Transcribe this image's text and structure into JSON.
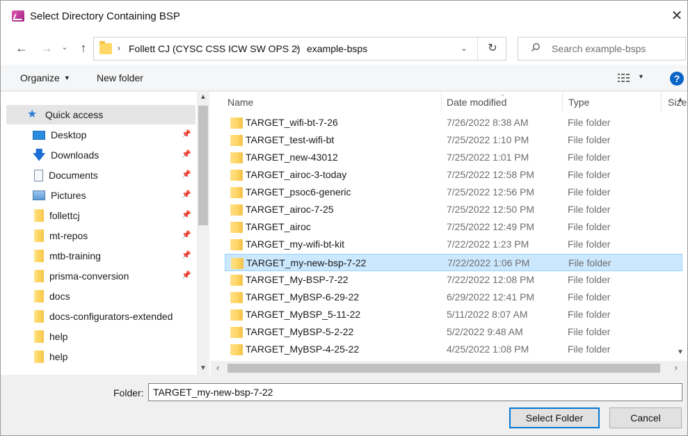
{
  "window": {
    "title": "Select Directory Containing BSP"
  },
  "address": {
    "crumbs": [
      "Follett CJ (CYSC CSS ICW SW OPS 2)",
      "example-bsps"
    ]
  },
  "search": {
    "placeholder": "Search example-bsps"
  },
  "toolbar": {
    "organize": "Organize",
    "new_folder": "New folder"
  },
  "sidebar": {
    "items": [
      {
        "label": "Quick access",
        "icon": "star-icon",
        "pinned": false
      },
      {
        "label": "Desktop",
        "icon": "desktop-icon",
        "pinned": true
      },
      {
        "label": "Downloads",
        "icon": "download-icon",
        "pinned": true
      },
      {
        "label": "Documents",
        "icon": "documents-icon",
        "pinned": true
      },
      {
        "label": "Pictures",
        "icon": "pictures-icon",
        "pinned": true
      },
      {
        "label": "follettcj",
        "icon": "folder-icon",
        "pinned": true
      },
      {
        "label": "mt-repos",
        "icon": "folder-icon",
        "pinned": true
      },
      {
        "label": "mtb-training",
        "icon": "folder-icon",
        "pinned": true
      },
      {
        "label": "prisma-conversion",
        "icon": "folder-icon",
        "pinned": true
      },
      {
        "label": "docs",
        "icon": "folder-icon",
        "pinned": false
      },
      {
        "label": "docs-configurators-extended",
        "icon": "folder-icon",
        "pinned": false
      },
      {
        "label": "help",
        "icon": "folder-icon",
        "pinned": false
      },
      {
        "label": "help",
        "icon": "folder-icon",
        "pinned": false
      }
    ]
  },
  "columns": {
    "name": "Name",
    "date": "Date modified",
    "type": "Type",
    "size": "Size"
  },
  "files": [
    {
      "name": "TARGET_wifi-bt-7-26",
      "date": "7/26/2022 8:38 AM",
      "type": "File folder"
    },
    {
      "name": "TARGET_test-wifi-bt",
      "date": "7/25/2022 1:10 PM",
      "type": "File folder"
    },
    {
      "name": "TARGET_new-43012",
      "date": "7/25/2022 1:01 PM",
      "type": "File folder"
    },
    {
      "name": "TARGET_airoc-3-today",
      "date": "7/25/2022 12:58 PM",
      "type": "File folder"
    },
    {
      "name": "TARGET_psoc6-generic",
      "date": "7/25/2022 12:56 PM",
      "type": "File folder"
    },
    {
      "name": "TARGET_airoc-7-25",
      "date": "7/25/2022 12:50 PM",
      "type": "File folder"
    },
    {
      "name": "TARGET_airoc",
      "date": "7/25/2022 12:49 PM",
      "type": "File folder"
    },
    {
      "name": "TARGET_my-wifi-bt-kit",
      "date": "7/22/2022 1:23 PM",
      "type": "File folder"
    },
    {
      "name": "TARGET_my-new-bsp-7-22",
      "date": "7/22/2022 1:06 PM",
      "type": "File folder"
    },
    {
      "name": "TARGET_My-BSP-7-22",
      "date": "7/22/2022 12:08 PM",
      "type": "File folder"
    },
    {
      "name": "TARGET_MyBSP-6-29-22",
      "date": "6/29/2022 12:41 PM",
      "type": "File folder"
    },
    {
      "name": "TARGET_MyBSP_5-11-22",
      "date": "5/11/2022 8:07 AM",
      "type": "File folder"
    },
    {
      "name": "TARGET_MyBSP-5-2-22",
      "date": "5/2/2022 9:48 AM",
      "type": "File folder"
    },
    {
      "name": "TARGET_MyBSP-4-25-22",
      "date": "4/25/2022 1:08 PM",
      "type": "File folder"
    }
  ],
  "selected_index": 8,
  "footer": {
    "folder_label": "Folder:",
    "folder_value": "TARGET_my-new-bsp-7-22",
    "select_button": "Select Folder",
    "cancel_button": "Cancel"
  }
}
